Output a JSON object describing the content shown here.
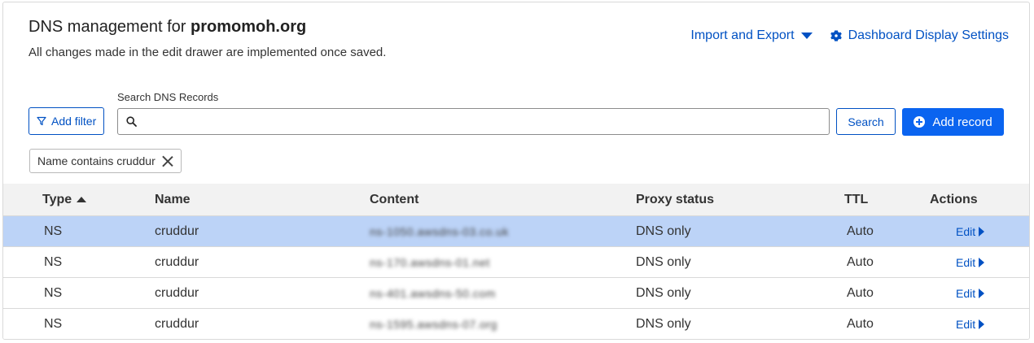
{
  "header": {
    "title_prefix": "DNS management for",
    "zone": "promomoh.org",
    "subtitle": "All changes made in the edit drawer are implemented once saved.",
    "import_export_label": "Import and Export",
    "dashboard_settings_label": "Dashboard Display Settings"
  },
  "toolbar": {
    "search_label": "Search DNS Records",
    "search_placeholder": "",
    "search_value": "",
    "add_filter_label": "Add filter",
    "search_button_label": "Search",
    "add_record_label": "Add record"
  },
  "filters": [
    {
      "label": "Name contains cruddur"
    }
  ],
  "table": {
    "columns": {
      "type": "Type",
      "name": "Name",
      "content": "Content",
      "proxy_status": "Proxy status",
      "ttl": "TTL",
      "actions": "Actions"
    },
    "sort": {
      "column": "type",
      "direction": "ascending"
    },
    "rows": [
      {
        "type": "NS",
        "name": "cruddur",
        "content": "ns-1050.awsdns-03.co.uk",
        "proxy_status": "DNS only",
        "ttl": "Auto",
        "action": "Edit",
        "selected": true
      },
      {
        "type": "NS",
        "name": "cruddur",
        "content": "ns-170.awsdns-01.net",
        "proxy_status": "DNS only",
        "ttl": "Auto",
        "action": "Edit",
        "selected": false
      },
      {
        "type": "NS",
        "name": "cruddur",
        "content": "ns-401.awsdns-50.com",
        "proxy_status": "DNS only",
        "ttl": "Auto",
        "action": "Edit",
        "selected": false
      },
      {
        "type": "NS",
        "name": "cruddur",
        "content": "ns-1595.awsdns-07.org",
        "proxy_status": "DNS only",
        "ttl": "Auto",
        "action": "Edit",
        "selected": false
      }
    ]
  },
  "colors": {
    "accent": "#0051c3",
    "primary_button": "#0a64f0",
    "selected_row": "#bcd3f7",
    "header_row": "#f2f2f2"
  }
}
